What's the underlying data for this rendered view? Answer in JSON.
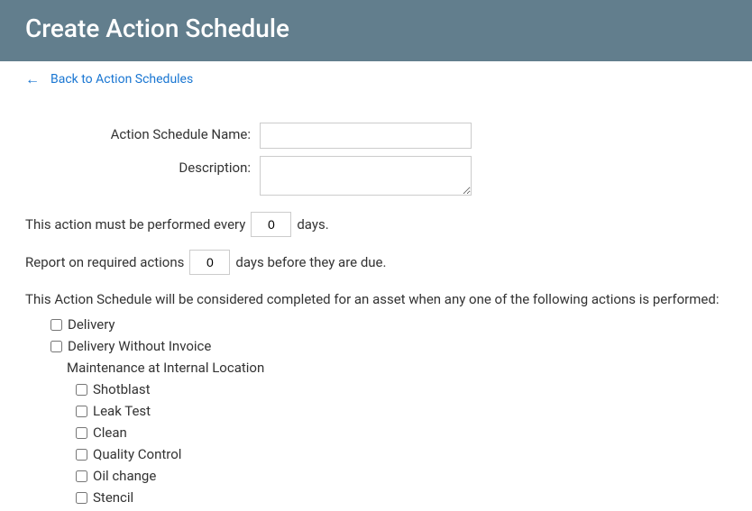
{
  "header": {
    "title": "Create Action Schedule"
  },
  "backLink": {
    "label": "Back to Action Schedules"
  },
  "form": {
    "nameLabel": "Action Schedule Name:",
    "nameValue": "",
    "descriptionLabel": "Description:",
    "descriptionValue": ""
  },
  "frequency": {
    "prefix": "This action must be performed every",
    "value": "0",
    "suffix": "days."
  },
  "report": {
    "prefix": "Report on required actions",
    "value": "0",
    "suffix": "days before they are due."
  },
  "completionText": "This Action Schedule will be considered completed for an asset when any one of the following actions is performed:",
  "actions": {
    "delivery": "Delivery",
    "deliveryWithoutInvoice": "Delivery Without Invoice",
    "maintenanceGroup": "Maintenance at Internal Location",
    "subActions": {
      "shotblast": "Shotblast",
      "leakTest": "Leak Test",
      "clean": "Clean",
      "qualityControl": "Quality Control",
      "oilChange": "Oil change",
      "stencil": "Stencil"
    }
  }
}
